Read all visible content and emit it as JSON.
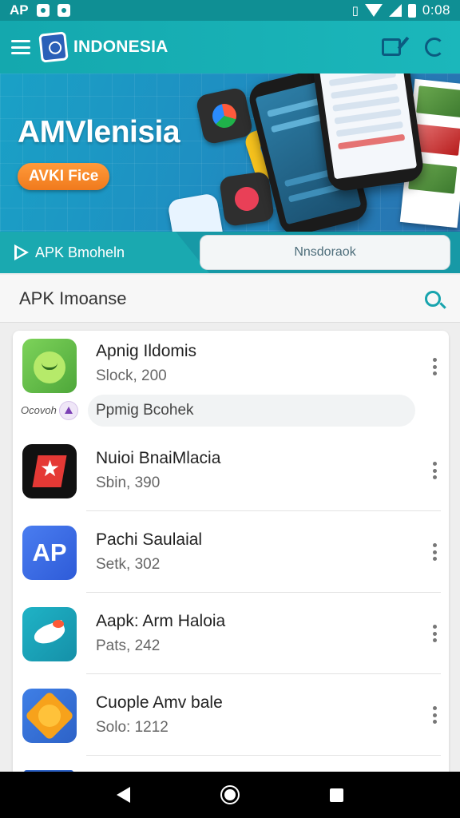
{
  "status_bar": {
    "carrier": "AP",
    "time": "0:08",
    "icons": [
      "notification-icon",
      "notification-icon",
      "vibrate-icon",
      "wifi-icon",
      "signal-icon",
      "battery-icon"
    ]
  },
  "app_bar": {
    "title": "INDONESIA",
    "icons": [
      "menu-icon",
      "edit-icon",
      "refresh-icon"
    ]
  },
  "hero": {
    "title": "AMVlenisia",
    "button_label": "AVKI Fice"
  },
  "search_band": {
    "label": "APK Bmoheln",
    "input_value": "Nnsdoraok"
  },
  "section": {
    "title": "APK Imoanse"
  },
  "apps": [
    {
      "name": "Apnig Ildomis",
      "subtitle": "Slock, 200",
      "icon": "android-app-icon"
    },
    {
      "name": "Nuioi BnaiMlacia",
      "subtitle": "Sbin, 390",
      "icon": "red-star-app-icon"
    },
    {
      "name": "Pachi Saulaial",
      "subtitle": "Setk, 302",
      "icon": "ap-app-icon"
    },
    {
      "name": "Aapk: Arm Haloia",
      "subtitle": "Pats, 242",
      "icon": "bird-app-icon"
    },
    {
      "name": "Cuople Amv bale",
      "subtitle": "Solo: 1212",
      "icon": "sun-app-icon"
    }
  ],
  "sub_row": {
    "tag": "Ocovoh",
    "pill": "Ppmig Bcohek"
  },
  "colors": {
    "primary": "#1bb7bb",
    "accent_orange": "#f07a1d",
    "hero_blue": "#1e8fc2"
  }
}
